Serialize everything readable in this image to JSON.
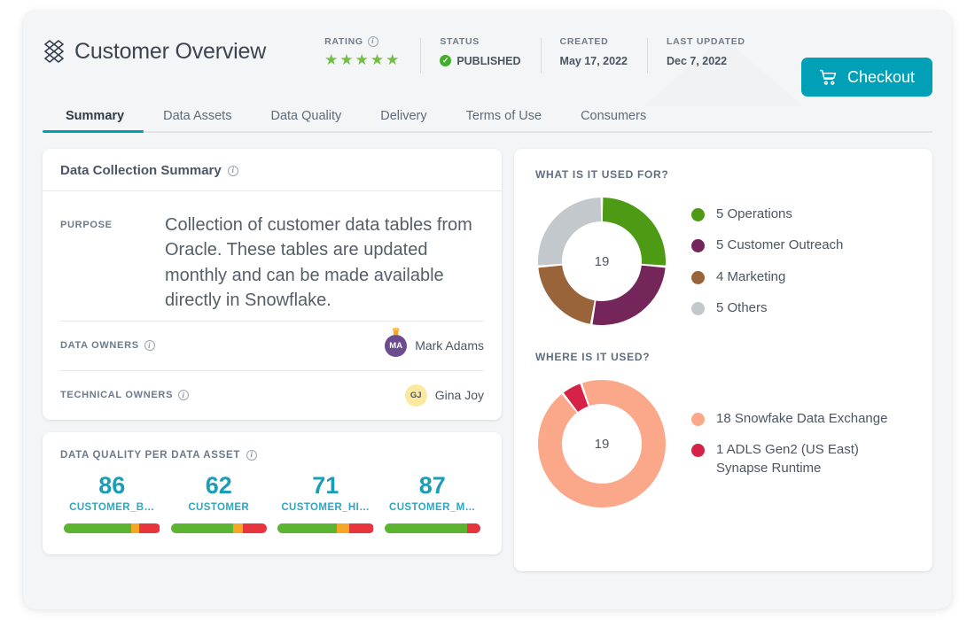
{
  "header": {
    "logo_icon": "lattice-diamond-logo",
    "title": "Customer Overview",
    "meta": [
      {
        "label": "RATING",
        "info_icon": "info-icon",
        "stars": "★★★★★",
        "rating_value": 5
      },
      {
        "label": "STATUS",
        "value": "PUBLISHED",
        "status_icon": "check-circle-icon"
      },
      {
        "label": "CREATED",
        "value": "May 17, 2022"
      },
      {
        "label": "LAST UPDATED",
        "value": "Dec 7, 2022"
      }
    ],
    "checkout": {
      "label": "Checkout",
      "icon": "shopping-cart-icon"
    }
  },
  "tabs": [
    {
      "label": "Summary",
      "active": true
    },
    {
      "label": "Data Assets",
      "active": false
    },
    {
      "label": "Data Quality",
      "active": false
    },
    {
      "label": "Delivery",
      "active": false
    },
    {
      "label": "Terms of Use",
      "active": false
    },
    {
      "label": "Consumers",
      "active": false
    }
  ],
  "summary_card": {
    "title": "Data Collection Summary",
    "purpose_label": "PURPOSE",
    "purpose_text": "Collection of customer data tables from Oracle. These tables are updated monthly and can be made available directly in Snowflake.",
    "data_owners_label": "DATA OWNERS",
    "data_owner_name": "Mark Adams",
    "data_owner_initials": "MA",
    "technical_owners_label": "TECHNICAL OWNERS",
    "technical_owner_name": "Gina Joy",
    "technical_owner_initials": "GJ"
  },
  "data_quality_card": {
    "title": "DATA QUALITY PER DATA ASSET",
    "assets": [
      {
        "score": "86",
        "name": "CUSTOMER_B…",
        "green": 70,
        "orange": 8,
        "red": 22
      },
      {
        "score": "62",
        "name": "CUSTOMER",
        "green": 65,
        "orange": 10,
        "red": 25
      },
      {
        "score": "71",
        "name": "CUSTOMER_HI…",
        "green": 62,
        "orange": 13,
        "red": 25
      },
      {
        "score": "87",
        "name": "CUSTOMER_M…",
        "green": 86,
        "orange": 0,
        "red": 14
      }
    ]
  },
  "chart_data": [
    {
      "type": "pie",
      "title": "WHAT IS IT USED FOR?",
      "center_label": "19",
      "total": 19,
      "legend_position": "right",
      "categories": [
        "Operations",
        "Customer Outreach",
        "Marketing",
        "Others"
      ],
      "values": [
        5,
        5,
        4,
        5
      ],
      "colors": [
        "#4d9a14",
        "#74265a",
        "#99643a",
        "#c3c8cd"
      ],
      "legend_labels": [
        "5 Operations",
        "5 Customer Outreach",
        "4 Marketing",
        "5 Others"
      ]
    },
    {
      "type": "pie",
      "title": "WHERE IS IT USED?",
      "center_label": "19",
      "total": 19,
      "legend_position": "right",
      "categories": [
        "Snowfake Data Exchange",
        "ADLS Gen2 (US East) Synapse Runtime"
      ],
      "values": [
        18,
        1
      ],
      "colors": [
        "#fba88a",
        "#d62246"
      ],
      "legend_labels": [
        "18 Snowfake Data Exchange",
        "1   ADLS Gen2 (US East)\n     Synapse Runtime"
      ]
    }
  ],
  "colors": {
    "accent_teal": "#00a0b4",
    "score_teal": "#1b9cb7",
    "star_green": "#72bf44",
    "status_green": "#3fae2a",
    "bar_green": "#5cb531",
    "bar_orange": "#f5a623",
    "bar_red": "#e8353d",
    "avatar_purple": "#6c4b8f",
    "avatar_yellow": "#fbe9a0",
    "page_bg": "#f4f5f6"
  }
}
